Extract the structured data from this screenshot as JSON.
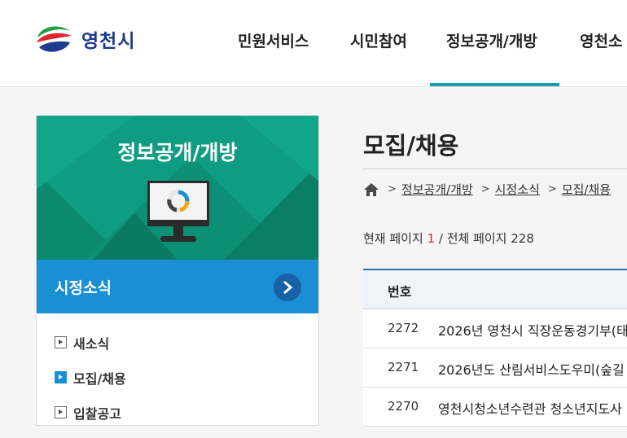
{
  "header": {
    "logo_text": "영천시",
    "nav": [
      {
        "label": "민원서비스"
      },
      {
        "label": "시민참여"
      },
      {
        "label": "정보공개/개방"
      },
      {
        "label": "영천소"
      }
    ],
    "active_color": "#1aa1a8"
  },
  "sidebar": {
    "title": "정보공개/개방",
    "section_label": "시정소식",
    "items": [
      {
        "label": "새소식"
      },
      {
        "label": "모집/채용"
      },
      {
        "label": "입찰공고"
      }
    ],
    "hero_color": "#0e9d82",
    "section_color": "#1a8fd3"
  },
  "main": {
    "title": "모집/채용",
    "breadcrumb": [
      "정보공개/개방",
      "시정소식",
      "모집/채용"
    ],
    "page_info": {
      "prefix": "현재 페이지",
      "current": "1",
      "sep": "/ 전체 페이지",
      "total": "228"
    },
    "table": {
      "header_no": "번호",
      "rows": [
        {
          "no": "2272",
          "title": "2026년 영천시 직장운동경기부(태"
        },
        {
          "no": "2271",
          "title": "2026년도 산림서비스도우미(숲길"
        },
        {
          "no": "2270",
          "title": "영천시청소년수련관 청소년지도사"
        }
      ]
    }
  }
}
